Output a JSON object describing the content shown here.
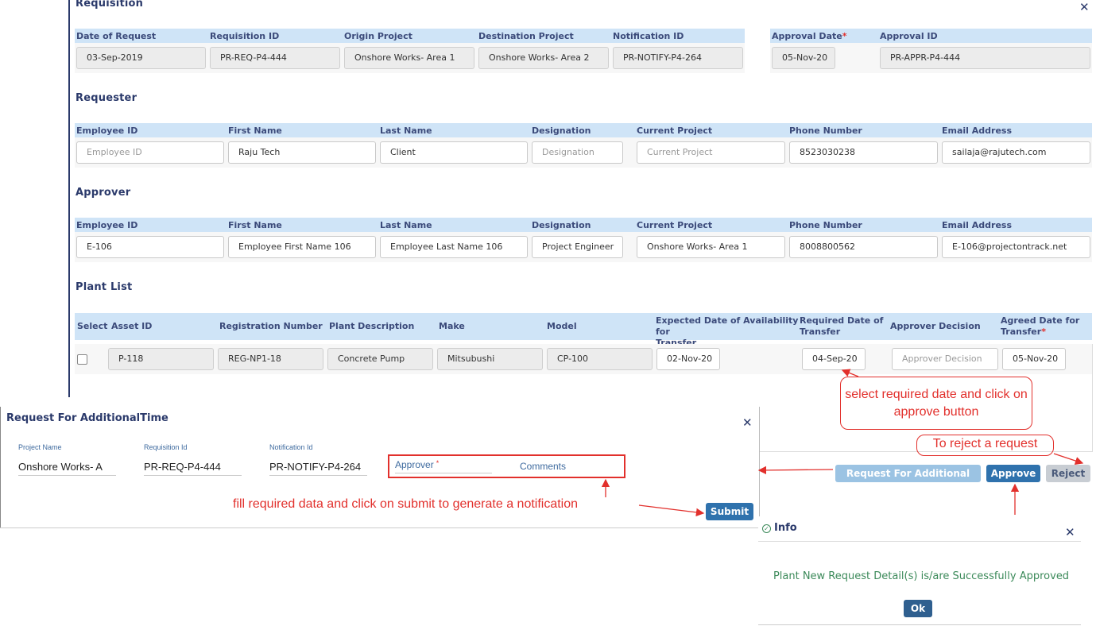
{
  "requisition": {
    "title": "Requisition",
    "headers": [
      "Date of Request",
      "Requisition ID",
      "Origin Project",
      "Destination Project",
      "Notification ID"
    ],
    "values": [
      "03-Sep-2019",
      "PR-REQ-P4-444",
      "Onshore  Works- Area 1",
      "Onshore  Works- Area 2",
      "PR-NOTIFY-P4-264"
    ],
    "approval_date_label": "Approval Date",
    "approval_id_label": "Approval ID",
    "approval_date": "05-Nov-20",
    "approval_id": "PR-APPR-P4-444",
    "required_mark": "*"
  },
  "requester": {
    "title": "Requester",
    "headers": [
      "Employee ID",
      "First Name",
      "Last Name",
      "Designation",
      "Current Project",
      "Phone Number",
      "Email Address"
    ],
    "values": [
      "Employee ID",
      "Raju Tech",
      "Client",
      "Designation",
      "Current Project",
      "8523030238",
      "sailaja@rajutech.com"
    ]
  },
  "approver": {
    "title": "Approver",
    "headers": [
      "Employee ID",
      "First Name",
      "Last Name",
      "Designation",
      "Current Project",
      "Phone Number",
      "Email Address"
    ],
    "values": [
      "E-106",
      "Employee First Name 106",
      "Employee Last Name 106",
      "Project Engineer",
      "Onshore  Works- Area 1",
      "8008800562",
      "E-106@projectontrack.net"
    ]
  },
  "plant_list": {
    "title": "Plant List",
    "headers": {
      "select": "Select",
      "asset_id": "Asset ID",
      "registration": "Registration Number",
      "description": "Plant Description",
      "make": "Make",
      "model": "Model",
      "expected_1": "Expected Date of Availability for",
      "expected_2": "Transfer",
      "required_1": "Required Date of",
      "required_2": "Transfer",
      "decision": "Approver Decision",
      "agreed_1": "Agreed Date for",
      "agreed_2": "Transfer"
    },
    "row": {
      "asset_id": "P-118",
      "registration": "REG-NP1-18",
      "description": "Concrete Pump",
      "make": "Mitsubushi",
      "model": "CP-100",
      "expected_date": "02-Nov-20",
      "required_date": "04-Sep-20",
      "decision_placeholder": "Approver Decision",
      "agreed_date": "05-Nov-20"
    }
  },
  "buttons": {
    "additional_time": "Request For Additional Time",
    "approve": "Approve",
    "reject": "Reject"
  },
  "dialog": {
    "title": "Request For AdditionalTime",
    "project_name_label": "Project Name",
    "project_name": "Onshore  Works- A",
    "requisition_id_label": "Requisition Id",
    "requisition_id": "PR-REQ-P4-444",
    "notification_id_label": "Notification Id",
    "notification_id": "PR-NOTIFY-P4-264",
    "approver_label": "Approver",
    "comments_label": "Comments",
    "submit": "Submit"
  },
  "info": {
    "title": "Info",
    "message": "Plant New Request Detail(s) is/are Successfully Approved",
    "ok": "Ok"
  },
  "annotations": {
    "select_date": "select required date and click on approve button",
    "reject": "To reject a request",
    "fill_data": "fill required data and click on submit to generate a notification"
  },
  "colors": {
    "header_bg": "#cfe4f7",
    "title_color": "#2b3a6b",
    "primary_button": "#2f72ad",
    "annotation_red": "#e2302c",
    "success_green": "#3c8a5a"
  }
}
